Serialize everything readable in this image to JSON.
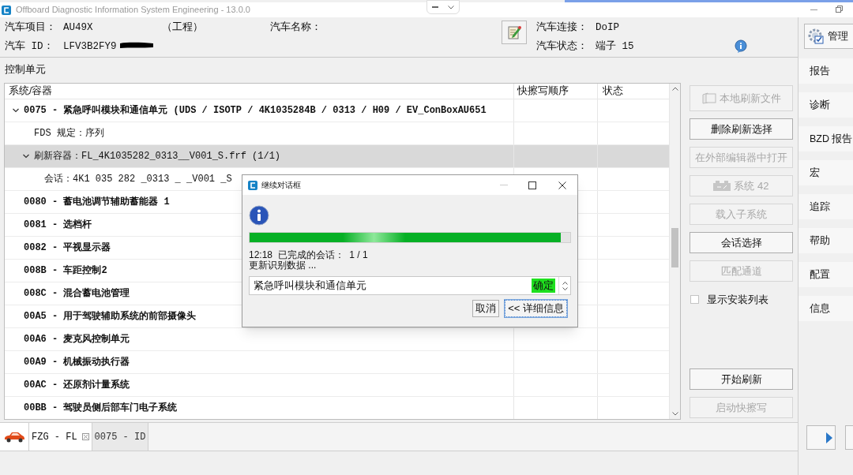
{
  "window": {
    "title": "Offboard Diagnostic Information System Engineering - 13.0.0"
  },
  "vehicle": {
    "project_label": "汽车项目：",
    "project_value": "AU49X",
    "project_note": "（工程）",
    "name_label": "汽车名称：",
    "id_label": "汽车 ID：",
    "id_value": "LFV3B2FY9",
    "connection_label": "汽车连接：",
    "connection_value": "DoIP",
    "status_label": "汽车状态：",
    "status_value": "端子 15"
  },
  "manage_button": {
    "label": "管理"
  },
  "nav": [
    "报告",
    "诊断",
    "BZD 报告",
    "宏",
    "追踪",
    "帮助",
    "配置",
    "信息"
  ],
  "control_units": {
    "title": "控制单元",
    "columns": [
      "系统/容器",
      "快擦写顺序",
      "状态"
    ],
    "rows": [
      {
        "text": "0075 - 紧急呼叫模块和通信单元  (UDS / ISOTP / 4K1035284B / 0313 / H09 / EV_ConBoxAU651",
        "expanded": true,
        "selected": false,
        "children": [
          {
            "text": "FDS 规定：序列",
            "selected": false
          },
          {
            "text": "刷新容器：FL_4K1035282_0313__V001_S.frf (1/1)",
            "expanded": true,
            "selected": true,
            "children": [
              {
                "text": "会话：4K1 035 282 _0313 _ _V001 _S",
                "selected": false
              }
            ]
          }
        ]
      },
      {
        "text": "0080 - 蓄电池调节辅助蓄能器 1",
        "selected": false
      },
      {
        "text": "0081 - 选档杆",
        "selected": false
      },
      {
        "text": "0082 - 平视显示器",
        "selected": false
      },
      {
        "text": "008B - 车距控制2",
        "selected": false
      },
      {
        "text": "008C - 混合蓄电池管理",
        "selected": false
      },
      {
        "text": "00A5 - 用于驾驶辅助系统的前部摄像头",
        "selected": false
      },
      {
        "text": "00A6 - 麦克风控制单元",
        "selected": false
      },
      {
        "text": "00A9 - 机械振动执行器",
        "selected": false
      },
      {
        "text": "00AC - 还原剂计量系统",
        "selected": false
      },
      {
        "text": "00BB - 驾驶员侧后部车门电子系统",
        "selected": false
      }
    ]
  },
  "actions_top": [
    {
      "kind": "file",
      "label": "本地刷新文件",
      "disabled": true
    },
    {
      "kind": "button",
      "label": "删除刷新选择",
      "disabled": false
    },
    {
      "kind": "button",
      "label": "在外部编辑器中打开",
      "disabled": true
    },
    {
      "kind": "system",
      "label": "系统 42",
      "disabled": true
    },
    {
      "kind": "button",
      "label": "载入子系统",
      "disabled": true
    },
    {
      "kind": "button",
      "label": "会话选择",
      "disabled": false
    },
    {
      "kind": "button",
      "label": "匹配通道",
      "disabled": true
    },
    {
      "kind": "checkbox",
      "label": "显示安装列表",
      "checked": false
    }
  ],
  "actions_bottom": [
    {
      "kind": "button",
      "label": "开始刷新",
      "disabled": false
    },
    {
      "kind": "button",
      "label": "启动快擦写",
      "disabled": true
    }
  ],
  "tabs": [
    {
      "label": "FZG - FL",
      "selected": true,
      "closable": true
    },
    {
      "label": "0075 - ID",
      "selected": false,
      "closable": false
    }
  ],
  "dialog": {
    "title": "继续对话框",
    "progress": {
      "level": 0.97
    },
    "status_line": "12:18  已完成的会话：  1 / 1",
    "activity": "更新识别数据 ...",
    "list_item": {
      "text": "紧急呼叫模块和通信单元",
      "badge": "确定"
    },
    "buttons": [
      {
        "label": "取消",
        "focused": false
      },
      {
        "label": "<< 详细信息",
        "focused": true
      }
    ]
  }
}
